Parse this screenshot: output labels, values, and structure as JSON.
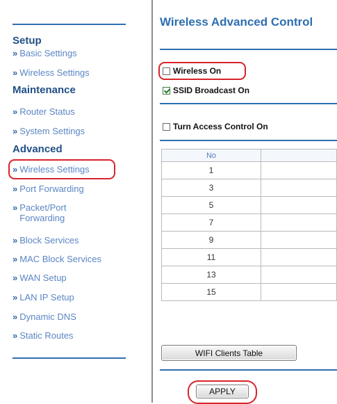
{
  "sidebar": {
    "sections": [
      {
        "title": "Setup",
        "items": [
          "Basic Settings",
          "Wireless Settings"
        ]
      },
      {
        "title": "Maintenance",
        "items": [
          "Router Status",
          "System Settings"
        ]
      },
      {
        "title": "Advanced",
        "items": [
          "Wireless Settings",
          "Port Forwarding",
          "Packet/Port",
          "Forwarding",
          "Block Services",
          "MAC Block Services",
          "WAN Setup",
          "LAN IP Setup",
          "Dynamic DNS",
          "Static Routes"
        ]
      }
    ],
    "chevron": "»"
  },
  "main": {
    "title": "Wireless Advanced Control",
    "wireless_on": {
      "label": "Wireless On",
      "checked": false
    },
    "ssid_broadcast": {
      "label": "SSID Broadcast On",
      "checked": true
    },
    "access_control": {
      "label": "Turn Access Control On",
      "checked": false
    },
    "table": {
      "header": "No",
      "rows": [
        "1",
        "3",
        "5",
        "7",
        "9",
        "11",
        "13",
        "15"
      ]
    },
    "wifi_clients_button": "WIFI Clients Table",
    "apply_button": "APPLY"
  },
  "colors": {
    "accent": "#2e6fb0",
    "link": "#5b86c4",
    "highlight_ring": "#d8232a"
  }
}
